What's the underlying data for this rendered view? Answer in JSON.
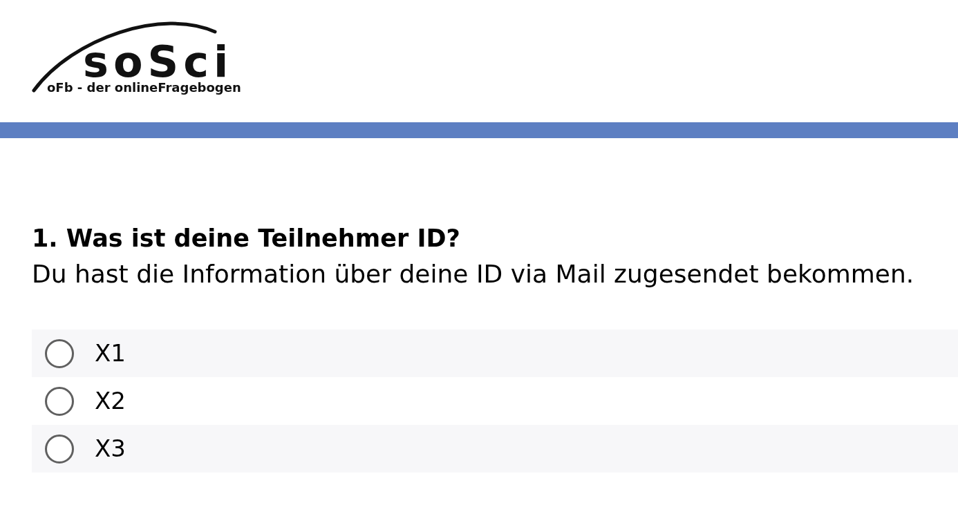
{
  "logo": {
    "name": "soSci",
    "tagline": "oFb - der onlineFragebogen"
  },
  "question": {
    "title": "1. Was ist deine Teilnehmer ID?",
    "description": "Du hast die Information über deine ID via Mail zugesendet bekommen.",
    "options": [
      {
        "label": "X1",
        "selected": false
      },
      {
        "label": "X2",
        "selected": false
      },
      {
        "label": "X3",
        "selected": false
      }
    ]
  }
}
